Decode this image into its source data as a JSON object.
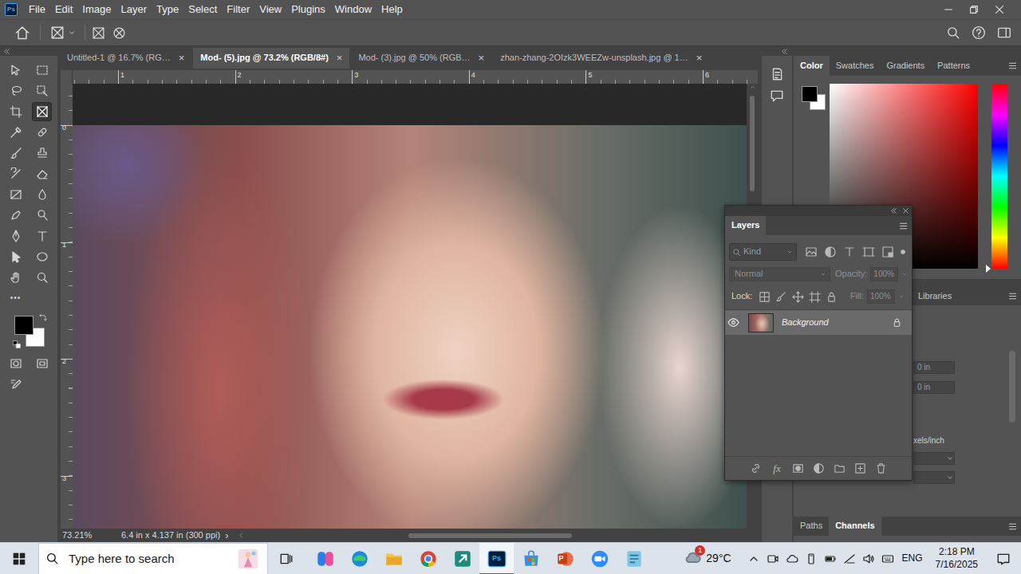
{
  "app": {
    "logo": "Ps"
  },
  "menu": [
    "File",
    "Edit",
    "Image",
    "Layer",
    "Type",
    "Select",
    "Filter",
    "View",
    "Plugins",
    "Window",
    "Help"
  ],
  "tools": [
    {
      "selected": false
    },
    {
      "selected": false
    },
    {
      "selected": false
    },
    {
      "selected": false
    },
    {
      "selected": false
    },
    {
      "selected": true
    },
    {
      "selected": false
    },
    {
      "selected": false
    },
    {
      "selected": false
    },
    {
      "selected": false
    },
    {
      "selected": false
    },
    {
      "selected": false
    },
    {
      "selected": false
    },
    {
      "selected": false
    },
    {
      "selected": false
    },
    {
      "selected": false
    },
    {
      "selected": false
    },
    {
      "selected": false
    },
    {
      "selected": false
    },
    {
      "selected": false
    },
    {
      "selected": false
    },
    {
      "selected": false
    }
  ],
  "more_tools": "•••",
  "toolbar_colors": {
    "foreground": "#000000",
    "background": "#ffffff"
  },
  "tabs": [
    {
      "label": "Untitled-1 @ 16.7% (RG…",
      "close": "×",
      "selected": false
    },
    {
      "label": "Mod- (5).jpg @ 73.2% (RGB/8#)",
      "close": "×",
      "selected": true
    },
    {
      "label": "Mod- (3).jpg @ 50% (RGB…",
      "close": "×",
      "selected": false
    },
    {
      "label": "zhan-zhang-2OIzk3WEEZw-unsplash.jpg @ 1…",
      "close": "×",
      "selected": false
    }
  ],
  "rulers": {
    "horizontal": [
      "1",
      "2",
      "3",
      "4",
      "5",
      "6"
    ],
    "vertical": [
      "0",
      "1",
      "2",
      "3"
    ]
  },
  "status_bar": {
    "zoom": "73.21%",
    "document": "6.4 in x 4.137 in (300 ppi)",
    "more": "›"
  },
  "color_panel": {
    "tabs": [
      {
        "label": "Color",
        "selected": true
      },
      {
        "label": "Swatches",
        "selected": false
      },
      {
        "label": "Gradients",
        "selected": false
      },
      {
        "label": "Patterns",
        "selected": false
      }
    ],
    "foreground": "#000000",
    "background": "#ffffff",
    "hue_level": 0
  },
  "libraries_panel": {
    "tab": "Libraries",
    "fields": [
      "0 in",
      "0 in"
    ],
    "resolution_unit": "xels/inch"
  },
  "bottom_panel": {
    "tabs": [
      {
        "label": "Paths",
        "selected": false
      },
      {
        "label": "Channels",
        "selected": true
      }
    ]
  },
  "layers_panel": {
    "tabs": [
      {
        "label": "Layers",
        "selected": true
      }
    ],
    "filter_placeholder": "Kind",
    "blend_mode": {
      "label": "Normal",
      "disabled": true
    },
    "opacity": {
      "label": "Opacity:",
      "value": "100%",
      "disabled": true
    },
    "lock_label": "Lock:",
    "fill": {
      "label": "Fill:",
      "value": "100%",
      "disabled": true
    },
    "layers": [
      {
        "name": "Background",
        "visible": true,
        "locked": true,
        "selected": true
      }
    ],
    "footer_fx": "fx"
  },
  "taskbar": {
    "search_placeholder": "Type here to search",
    "apps": [
      {
        "selected": false
      },
      {
        "selected": false
      },
      {
        "selected": false
      },
      {
        "selected": false
      },
      {
        "selected": false
      },
      {
        "label": "Ps",
        "selected": true
      },
      {
        "selected": false
      },
      {
        "label": "P",
        "selected": false
      },
      {
        "selected": false
      },
      {
        "selected": false
      }
    ],
    "weather": {
      "temperature": "29°C",
      "badge": "1"
    },
    "language": "ENG",
    "time": "2:18 PM",
    "date": "7/16/2025"
  }
}
